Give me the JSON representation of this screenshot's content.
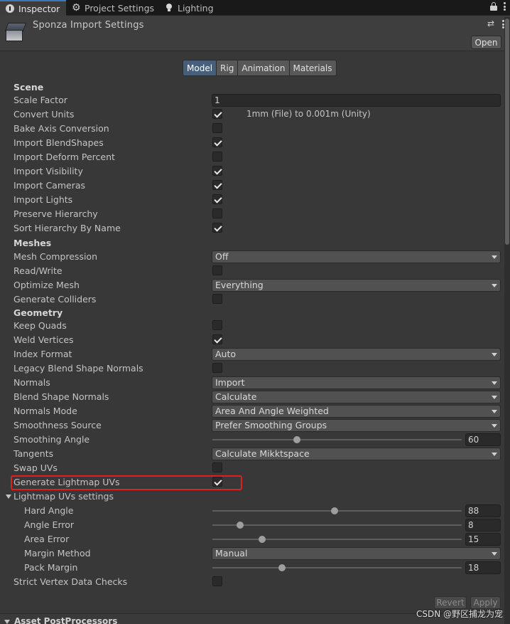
{
  "tabs": [
    {
      "label": "Inspector",
      "icon": "info-icon",
      "active": true
    },
    {
      "label": "Project Settings",
      "icon": "gear-icon",
      "active": false
    },
    {
      "label": "Lighting",
      "icon": "lightbulb-icon",
      "active": false
    }
  ],
  "header": {
    "title": "Sponza Import Settings",
    "open_label": "Open"
  },
  "toolbar": [
    "Model",
    "Rig",
    "Animation",
    "Materials"
  ],
  "active_toolbar": "Model",
  "rows": [
    {
      "label": "Scene",
      "kind": "section"
    },
    {
      "label": "Scale Factor",
      "kind": "text",
      "value": "1"
    },
    {
      "label": "Convert Units",
      "kind": "checkbox",
      "checked": true,
      "note": "1mm (File) to 0.001m (Unity)"
    },
    {
      "label": "Bake Axis Conversion",
      "kind": "checkbox",
      "checked": false
    },
    {
      "label": "Import BlendShapes",
      "kind": "checkbox",
      "checked": true
    },
    {
      "label": "Import Deform Percent",
      "kind": "checkbox",
      "checked": false
    },
    {
      "label": "Import Visibility",
      "kind": "checkbox",
      "checked": true
    },
    {
      "label": "Import Cameras",
      "kind": "checkbox",
      "checked": true
    },
    {
      "label": "Import Lights",
      "kind": "checkbox",
      "checked": true
    },
    {
      "label": "Preserve Hierarchy",
      "kind": "checkbox",
      "checked": false
    },
    {
      "label": "Sort Hierarchy By Name",
      "kind": "checkbox",
      "checked": true
    },
    {
      "label": "Meshes",
      "kind": "section"
    },
    {
      "label": "Mesh Compression",
      "kind": "dropdown",
      "value": "Off"
    },
    {
      "label": "Read/Write",
      "kind": "checkbox",
      "checked": false
    },
    {
      "label": "Optimize Mesh",
      "kind": "dropdown",
      "value": "Everything"
    },
    {
      "label": "Generate Colliders",
      "kind": "checkbox",
      "checked": false
    },
    {
      "label": "Geometry",
      "kind": "section"
    },
    {
      "label": "Keep Quads",
      "kind": "checkbox",
      "checked": false
    },
    {
      "label": "Weld Vertices",
      "kind": "checkbox",
      "checked": true
    },
    {
      "label": "Index Format",
      "kind": "dropdown",
      "value": "Auto"
    },
    {
      "label": "Legacy Blend Shape Normals",
      "kind": "checkbox",
      "checked": false
    },
    {
      "label": "Normals",
      "kind": "dropdown",
      "value": "Import"
    },
    {
      "label": "Blend Shape Normals",
      "kind": "dropdown",
      "value": "Calculate"
    },
    {
      "label": "Normals Mode",
      "kind": "dropdown",
      "value": "Area And Angle Weighted"
    },
    {
      "label": "Smoothness Source",
      "kind": "dropdown",
      "value": "Prefer Smoothing Groups"
    },
    {
      "label": "Smoothing Angle",
      "kind": "slider",
      "value": "60",
      "fraction": 0.34
    },
    {
      "label": "Tangents",
      "kind": "dropdown",
      "value": "Calculate Mikktspace"
    },
    {
      "label": "Swap UVs",
      "kind": "checkbox",
      "checked": false
    },
    {
      "label": "Generate Lightmap UVs",
      "kind": "checkbox",
      "checked": true,
      "highlighted": true
    },
    {
      "label": "Lightmap UVs settings",
      "kind": "foldout"
    },
    {
      "label": "Hard Angle",
      "kind": "slider",
      "value": "88",
      "fraction": 0.49,
      "indent": true
    },
    {
      "label": "Angle Error",
      "kind": "slider",
      "value": "8",
      "fraction": 0.11,
      "indent": true
    },
    {
      "label": "Area Error",
      "kind": "slider",
      "value": "15",
      "fraction": 0.2,
      "indent": true
    },
    {
      "label": "Margin Method",
      "kind": "dropdown",
      "value": "Manual",
      "indent": true
    },
    {
      "label": "Pack Margin",
      "kind": "slider",
      "value": "18",
      "fraction": 0.28,
      "indent": true
    },
    {
      "label": "Strict Vertex Data Checks",
      "kind": "checkbox",
      "checked": false
    }
  ],
  "footer": {
    "revert_label": "Revert",
    "apply_label": "Apply",
    "next_section": "Asset PostProcessors",
    "watermark": "CSDN @野区捕龙为宠"
  },
  "colors": {
    "background": "#383838",
    "active_tab": "#46607c",
    "highlight_box": "#e0201c"
  }
}
